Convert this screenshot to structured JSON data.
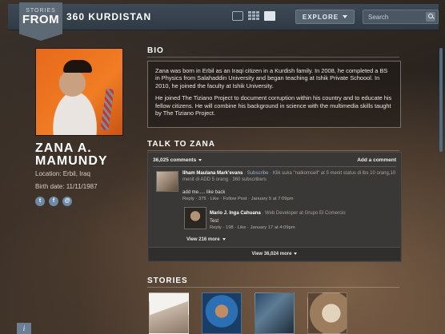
{
  "header": {
    "logo_small": "STORIES",
    "logo_big": "FROM",
    "site_name": "360 KURDISTAN",
    "explore_label": "EXPLORE",
    "search_placeholder": "Search"
  },
  "profile": {
    "name": "ZANA A. MAMUNDY",
    "location": "Location: Erbil, Iraq",
    "birth_date": "Birth date: 11/11/1987",
    "social_icons": [
      "twitter-icon",
      "facebook-icon",
      "email-icon"
    ]
  },
  "bio": {
    "title": "BIO",
    "paragraph1": "Zana was born in Erbil as an Iraqi citizen in a Kurdish family. In 2008, he completed a BS in Physics from Salahaddin University and began teaching at Ishik Private Schoool. In 2010, he joined the faculty at Ishik University.",
    "paragraph2": "He joined The Tiziano Project to document corruption within his country and to educate his fellow citizens. He will combine his background in science with the multimedia skills taught by The Tiziano Project."
  },
  "talk": {
    "title": "TALK TO ZANA",
    "comment_count": "36,025 comments",
    "add_comment": "Add a comment",
    "comment1": {
      "author": "Ilham Maulana Mark'evans",
      "subscribe": "· Subscribe",
      "meta": "· Klik suka \"nalkomsell\" at 5 menit status di lbs 10 orang,10 menit di ADD 5 orang · 360 subscribers",
      "body": "add me..... like back",
      "actions": "Reply · 375 · Like · Follow Post · January 5 at 7:09pm"
    },
    "comment2": {
      "author": "Mario J. Inga Cahuana",
      "meta": "· Web Developer at Grupo El Comercio",
      "body": "Test",
      "actions": "Reply · 198 · Like · January 17 at 4:09pm"
    },
    "view_replies": "View 216 more",
    "view_all": "View 36,024 more"
  },
  "stories": {
    "title": "STORIES"
  },
  "info_label": "i",
  "colors": {
    "topbar": "#3d4a55",
    "logo_tab": "#5d6a75",
    "comments_bg": "#3a3836",
    "social_icon": "#6d8aa6"
  }
}
